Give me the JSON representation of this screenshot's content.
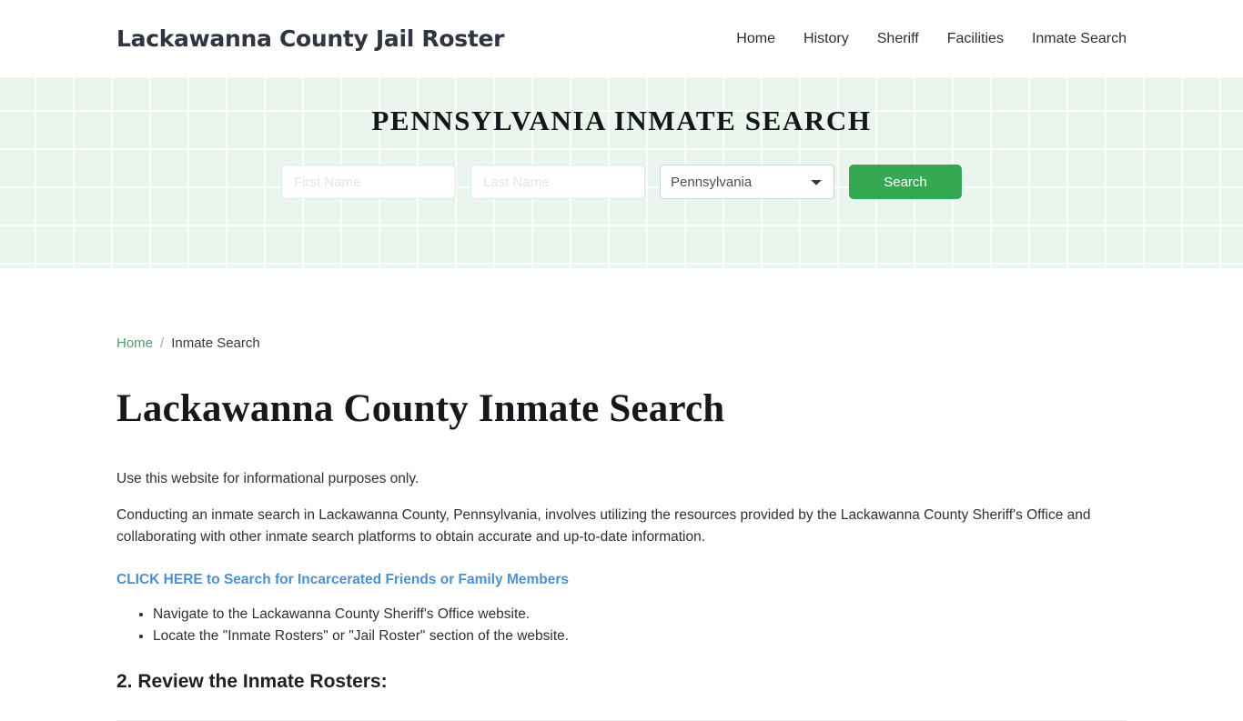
{
  "header": {
    "brand": "Lackawanna County Jail Roster",
    "nav": [
      {
        "label": "Home"
      },
      {
        "label": "History"
      },
      {
        "label": "Sheriff"
      },
      {
        "label": "Facilities"
      },
      {
        "label": "Inmate Search"
      }
    ]
  },
  "hero": {
    "title": "PENNSYLVANIA INMATE SEARCH",
    "background_color": "#eaf5ee",
    "form": {
      "first_name_placeholder": "First Name",
      "first_name_value": "",
      "last_name_placeholder": "Last Name",
      "last_name_value": "",
      "state_selected": "Pennsylvania",
      "state_options": [
        "Pennsylvania"
      ],
      "search_label": "Search",
      "search_color": "#34a853"
    }
  },
  "breadcrumb": {
    "home": "Home",
    "separator": "/",
    "current": "Inmate Search",
    "link_color": "#4a9d6b"
  },
  "main": {
    "title": "Lackawanna County Inmate Search",
    "intro": "Use this website for informational purposes only.",
    "paragraph": "Conducting an inmate search in Lackawanna County, Pennsylvania, involves utilizing the resources provided by the Lackawanna County Sheriff's Office and collaborating with other inmate search platforms to obtain accurate and up-to-date information.",
    "cta": "CLICK HERE to Search for Incarcerated Friends or Family Members",
    "cta_color": "#4a90d0",
    "bullets": [
      "Navigate to the Lackawanna County Sheriff's Office website.",
      "Locate the \"Inmate Rosters\" or \"Jail Roster\" section of the website."
    ],
    "section_heading": "2. Review the Inmate Rosters:"
  }
}
